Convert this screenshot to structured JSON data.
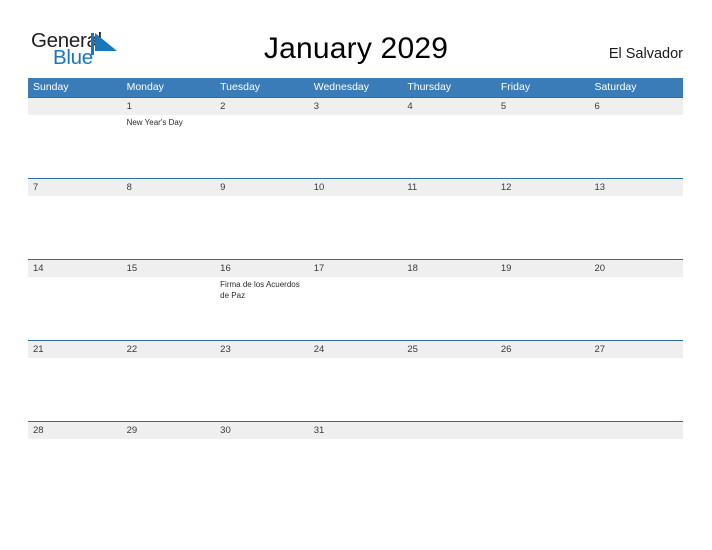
{
  "brand": {
    "name_line1": "General",
    "name_line2": "Blue",
    "logo_icon": "blue-triangle-flag-icon",
    "color_dark": "#231f20",
    "color_blue": "#1878be"
  },
  "header": {
    "title": "January 2029",
    "region": "El Salvador"
  },
  "theme": {
    "header_blue": "#3a7cb8",
    "divider_blue": "#2e6da4",
    "date_strip_gray": "#efefef",
    "text_dark": "#3a3a3a"
  },
  "calendar": {
    "month": "January",
    "year": "2029",
    "weekday_headers": [
      "Sunday",
      "Monday",
      "Tuesday",
      "Wednesday",
      "Thursday",
      "Friday",
      "Saturday"
    ],
    "weeks": [
      {
        "dates": [
          "",
          "1",
          "2",
          "3",
          "4",
          "5",
          "6"
        ],
        "events": [
          "",
          "New Year's Day",
          "",
          "",
          "",
          "",
          ""
        ]
      },
      {
        "dates": [
          "7",
          "8",
          "9",
          "10",
          "11",
          "12",
          "13"
        ],
        "events": [
          "",
          "",
          "",
          "",
          "",
          "",
          ""
        ]
      },
      {
        "dates": [
          "14",
          "15",
          "16",
          "17",
          "18",
          "19",
          "20"
        ],
        "events": [
          "",
          "",
          "Firma de los Acuerdos de Paz",
          "",
          "",
          "",
          ""
        ]
      },
      {
        "dates": [
          "21",
          "22",
          "23",
          "24",
          "25",
          "26",
          "27"
        ],
        "events": [
          "",
          "",
          "",
          "",
          "",
          "",
          ""
        ]
      },
      {
        "dates": [
          "28",
          "29",
          "30",
          "31",
          "",
          "",
          ""
        ],
        "events": [
          "",
          "",
          "",
          "",
          "",
          "",
          ""
        ]
      }
    ]
  }
}
